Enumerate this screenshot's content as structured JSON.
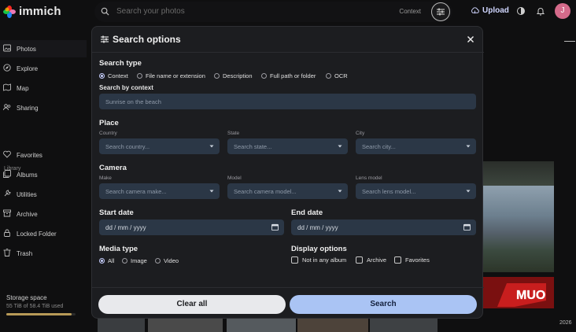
{
  "app": {
    "name": "immich"
  },
  "topbar": {
    "search_placeholder": "Search your photos",
    "search_mode": "Context",
    "upload_label": "Upload",
    "avatar_initial": "J"
  },
  "sidebar": {
    "items": [
      {
        "label": "Photos",
        "icon": "photos-icon",
        "active": true
      },
      {
        "label": "Explore",
        "icon": "explore-icon"
      },
      {
        "label": "Map",
        "icon": "map-icon"
      },
      {
        "label": "Sharing",
        "icon": "sharing-icon"
      }
    ],
    "library_label": "Library",
    "library_items": [
      {
        "label": "Favorites",
        "icon": "heart-icon"
      },
      {
        "label": "Albums",
        "icon": "albums-icon"
      },
      {
        "label": "Utilities",
        "icon": "utilities-icon"
      },
      {
        "label": "Archive",
        "icon": "archive-icon"
      },
      {
        "label": "Locked Folder",
        "icon": "lock-icon"
      },
      {
        "label": "Trash",
        "icon": "trash-icon"
      }
    ],
    "storage": {
      "title": "Storage space",
      "used": "55 TiB of 58.4 TiB used",
      "fraction": 0.94
    }
  },
  "timeline": {
    "year": "2026"
  },
  "modal": {
    "title": "Search options",
    "search_type": {
      "title": "Search type",
      "options": [
        "Context",
        "File name or extension",
        "Description",
        "Full path or folder",
        "OCR"
      ],
      "selected": "Context"
    },
    "search_by_context": {
      "label": "Search by context",
      "placeholder": "Sunrise on the beach"
    },
    "place": {
      "title": "Place",
      "country": {
        "label": "Country",
        "placeholder": "Search country..."
      },
      "state": {
        "label": "State",
        "placeholder": "Search state..."
      },
      "city": {
        "label": "City",
        "placeholder": "Search city..."
      }
    },
    "camera": {
      "title": "Camera",
      "make": {
        "label": "Make",
        "placeholder": "Search camera make..."
      },
      "model": {
        "label": "Model",
        "placeholder": "Search camera model..."
      },
      "lens": {
        "label": "Lens model",
        "placeholder": "Search lens model..."
      }
    },
    "start_date": {
      "title": "Start date",
      "value": "dd / mm / yyyy"
    },
    "end_date": {
      "title": "End date",
      "value": "dd / mm / yyyy"
    },
    "media_type": {
      "title": "Media type",
      "options": [
        "All",
        "Image",
        "Video"
      ],
      "selected": "All"
    },
    "display_options": {
      "title": "Display options",
      "options": [
        "Not in any album",
        "Archive",
        "Favorites"
      ]
    },
    "buttons": {
      "clear": "Clear all",
      "search": "Search"
    }
  },
  "colors": {
    "accent": "#aac4f4",
    "input_bg": "#2b3746",
    "modal_bg": "#1c1d20"
  }
}
